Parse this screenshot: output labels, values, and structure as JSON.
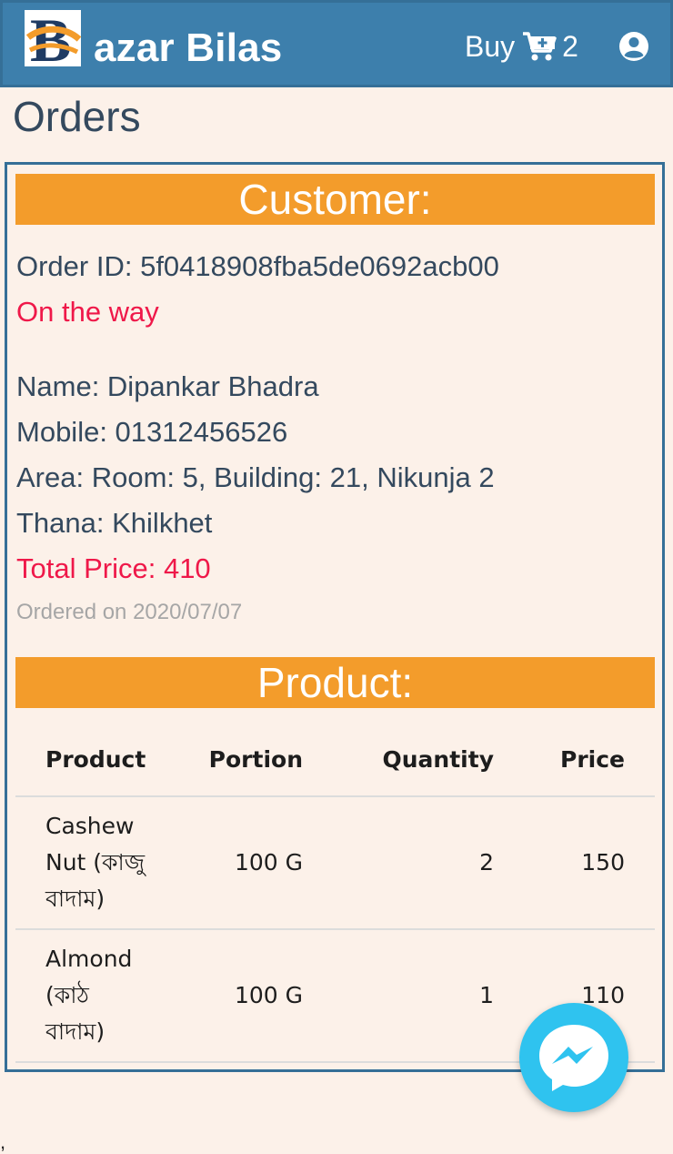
{
  "header": {
    "brand_letter": "B",
    "brand_name": "azar Bilas",
    "buy_label": "Buy",
    "cart_count": "2",
    "colors": {
      "navbar": "#3d7fac",
      "accent": "#f39c2b",
      "alert": "#ef1849"
    }
  },
  "page": {
    "title": "Orders"
  },
  "order": {
    "customer_header": "Customer:",
    "order_id": "Order ID: 5f0418908fba5de0692acb00",
    "status": "On the way",
    "name": "Name: Dipankar Bhadra",
    "mobile": "Mobile: 01312456526",
    "area": "Area: Room: 5, Building: 21, Nikunja 2",
    "thana": "Thana: Khilkhet",
    "total_price": "Total Price: 410",
    "ordered_on": "Ordered on 2020/07/07",
    "product_header": "Product:",
    "table": {
      "columns": [
        "Product",
        "Portion",
        "Quantity",
        "Price"
      ],
      "rows": [
        {
          "product": "Cashew Nut (কাজু বাদাম)",
          "portion": "100 G",
          "quantity": "2",
          "price": "150"
        },
        {
          "product": "Almond (কাঠ বাদাম)",
          "portion": "100 G",
          "quantity": "1",
          "price": "110"
        }
      ]
    }
  },
  "icons": {
    "cart": "cart-plus-icon",
    "account": "user-circle-icon",
    "chat": "messenger-icon"
  },
  "misc": {
    "stray_mark": ","
  }
}
